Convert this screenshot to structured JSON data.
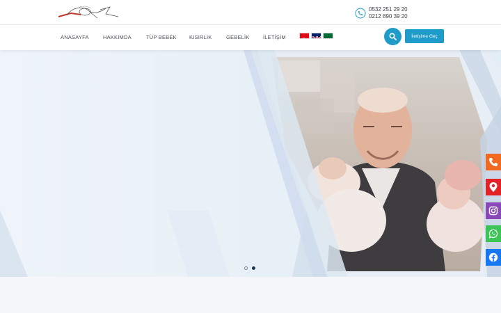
{
  "header": {
    "phones": [
      "0532 251 29 20",
      "0212 890 39 20"
    ]
  },
  "nav": {
    "items": [
      "ANASAYFA",
      "HAKKIMDA",
      "TÜP BEBEK",
      "KISIRLIK",
      "GEBELİK",
      "İLETİŞİM"
    ],
    "languages": [
      "tr-flag-icon",
      "uk-flag-icon",
      "sa-flag-icon"
    ],
    "contact_label": "İletişime Geç"
  },
  "hero": {
    "slides": 2,
    "active_slide": 2
  },
  "social": [
    "phone-icon",
    "location-icon",
    "instagram-icon",
    "whatsapp-icon",
    "facebook-icon"
  ],
  "colors": {
    "primary": "#1e9bc8",
    "phone": "#f26a21",
    "location": "#e32227",
    "instagram": "#8a48b8",
    "whatsapp": "#3cc456",
    "facebook": "#1877f2"
  }
}
